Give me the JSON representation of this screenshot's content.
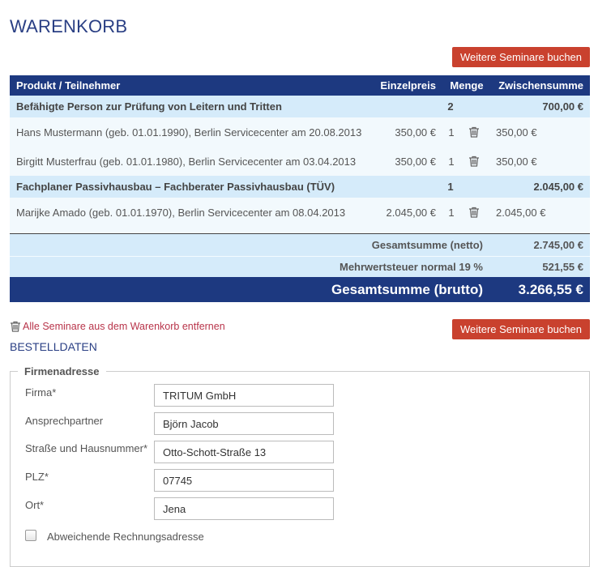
{
  "page_title": "WARENKORB",
  "buttons": {
    "more_seminars": "Weitere Seminare buchen"
  },
  "table": {
    "columns": [
      "Produkt / Teilnehmer",
      "Einzelpreis",
      "Menge",
      "Zwischensumme"
    ],
    "products": [
      {
        "name": "Befähigte Person zur Prüfung von Leitern und Tritten",
        "quantity": "2",
        "subtotal": "700,00 €",
        "participants": [
          {
            "desc": "Hans Mustermann (geb. 01.01.1990), Berlin Servicecenter am 20.08.2013",
            "price": "350,00 €",
            "qty": "1",
            "subtotal": "350,00 €"
          },
          {
            "desc": "Birgitt Musterfrau (geb. 01.01.1980), Berlin Servicecenter am 03.04.2013",
            "price": "350,00 €",
            "qty": "1",
            "subtotal": "350,00 €"
          }
        ]
      },
      {
        "name": "Fachplaner Passivhausbau – Fachberater Passivhausbau (TÜV)",
        "quantity": "1",
        "subtotal": "2.045,00 €",
        "participants": [
          {
            "desc": "Marijke Amado (geb. 01.01.1970), Berlin Servicecenter am 08.04.2013",
            "price": "2.045,00 €",
            "qty": "1",
            "subtotal": "2.045,00 €"
          }
        ]
      }
    ],
    "totals": {
      "net_label": "Gesamtsumme (netto)",
      "net_value": "2.745,00 €",
      "vat_label": "Mehrwertsteuer normal 19 %",
      "vat_value": "521,55 €",
      "gross_label": "Gesamtsumme (brutto)",
      "gross_value": "3.266,55 €"
    }
  },
  "remove_all_label": "Alle Seminare aus dem Warenkorb entfernen",
  "section_title": "BESTELLDATEN",
  "form": {
    "legend": "Firmenadresse",
    "fields": [
      {
        "label": "Firma*",
        "value": "TRITUM GmbH"
      },
      {
        "label": "Ansprechpartner",
        "value": "Björn Jacob"
      },
      {
        "label": "Straße und Hausnummer*",
        "value": "Otto-Schott-Straße 13"
      },
      {
        "label": "PLZ*",
        "value": "07745"
      },
      {
        "label": "Ort*",
        "value": "Jena"
      }
    ],
    "checkbox_label": "Abweichende Rechnungsadresse",
    "checkbox_checked": false
  },
  "icons": {
    "delete": "trash-icon"
  },
  "colors": {
    "primary": "#1d3980",
    "accent_button": "#c9412e",
    "row_highlight": "#d5ebfa",
    "link_red": "#b8344a"
  }
}
